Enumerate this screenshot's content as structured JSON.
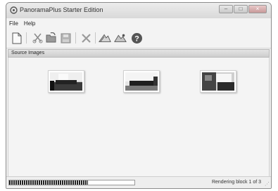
{
  "window": {
    "title": "PanoramaPlus Starter Edition"
  },
  "window_controls": {
    "minimize": "–",
    "maximize": "□",
    "close": "×"
  },
  "menu": {
    "items": [
      "File",
      "Help"
    ]
  },
  "toolbar": {
    "buttons": [
      "new-document-icon",
      "cut-icon",
      "open-icon",
      "save-icon",
      "delete-icon",
      "stitch-icon",
      "stitch-auto-icon",
      "help-icon"
    ]
  },
  "panel": {
    "header": "Source Images"
  },
  "thumbnails": [
    {
      "name": "source-image-1"
    },
    {
      "name": "source-image-2"
    },
    {
      "name": "source-image-3"
    }
  ],
  "status": {
    "text": "Rendering block 1 of 3",
    "progress_fraction": 0.63
  },
  "colors": {
    "window_bg": "#f0f0f0",
    "panel_header": "#d6d6d6",
    "progress": "#222222"
  }
}
